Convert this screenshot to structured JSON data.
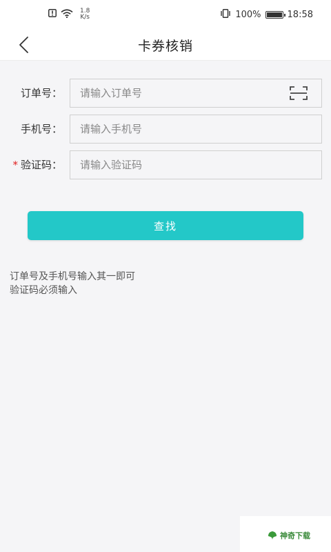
{
  "status_bar": {
    "speed_value": "1.8",
    "speed_unit": "K/s",
    "battery": "100%",
    "battery_level": 1.0,
    "time": "18:58"
  },
  "nav": {
    "title": "卡券核销",
    "back_icon": "chevron-left-icon"
  },
  "form": {
    "order": {
      "label": "订单号：",
      "placeholder": "请输入订单号",
      "value": "",
      "scan_icon": "scan-icon"
    },
    "phone": {
      "label": "手机号：",
      "placeholder": "请输入手机号",
      "value": ""
    },
    "code": {
      "required_mark": "*",
      "label": "验证码：",
      "placeholder": "请输入验证码",
      "value": ""
    }
  },
  "search_button": {
    "label": "查找",
    "color": "#23c8c8"
  },
  "hints": [
    "订单号及手机号输入其一即可",
    "验证码必须输入"
  ],
  "watermark": {
    "text": "神奇下载"
  }
}
